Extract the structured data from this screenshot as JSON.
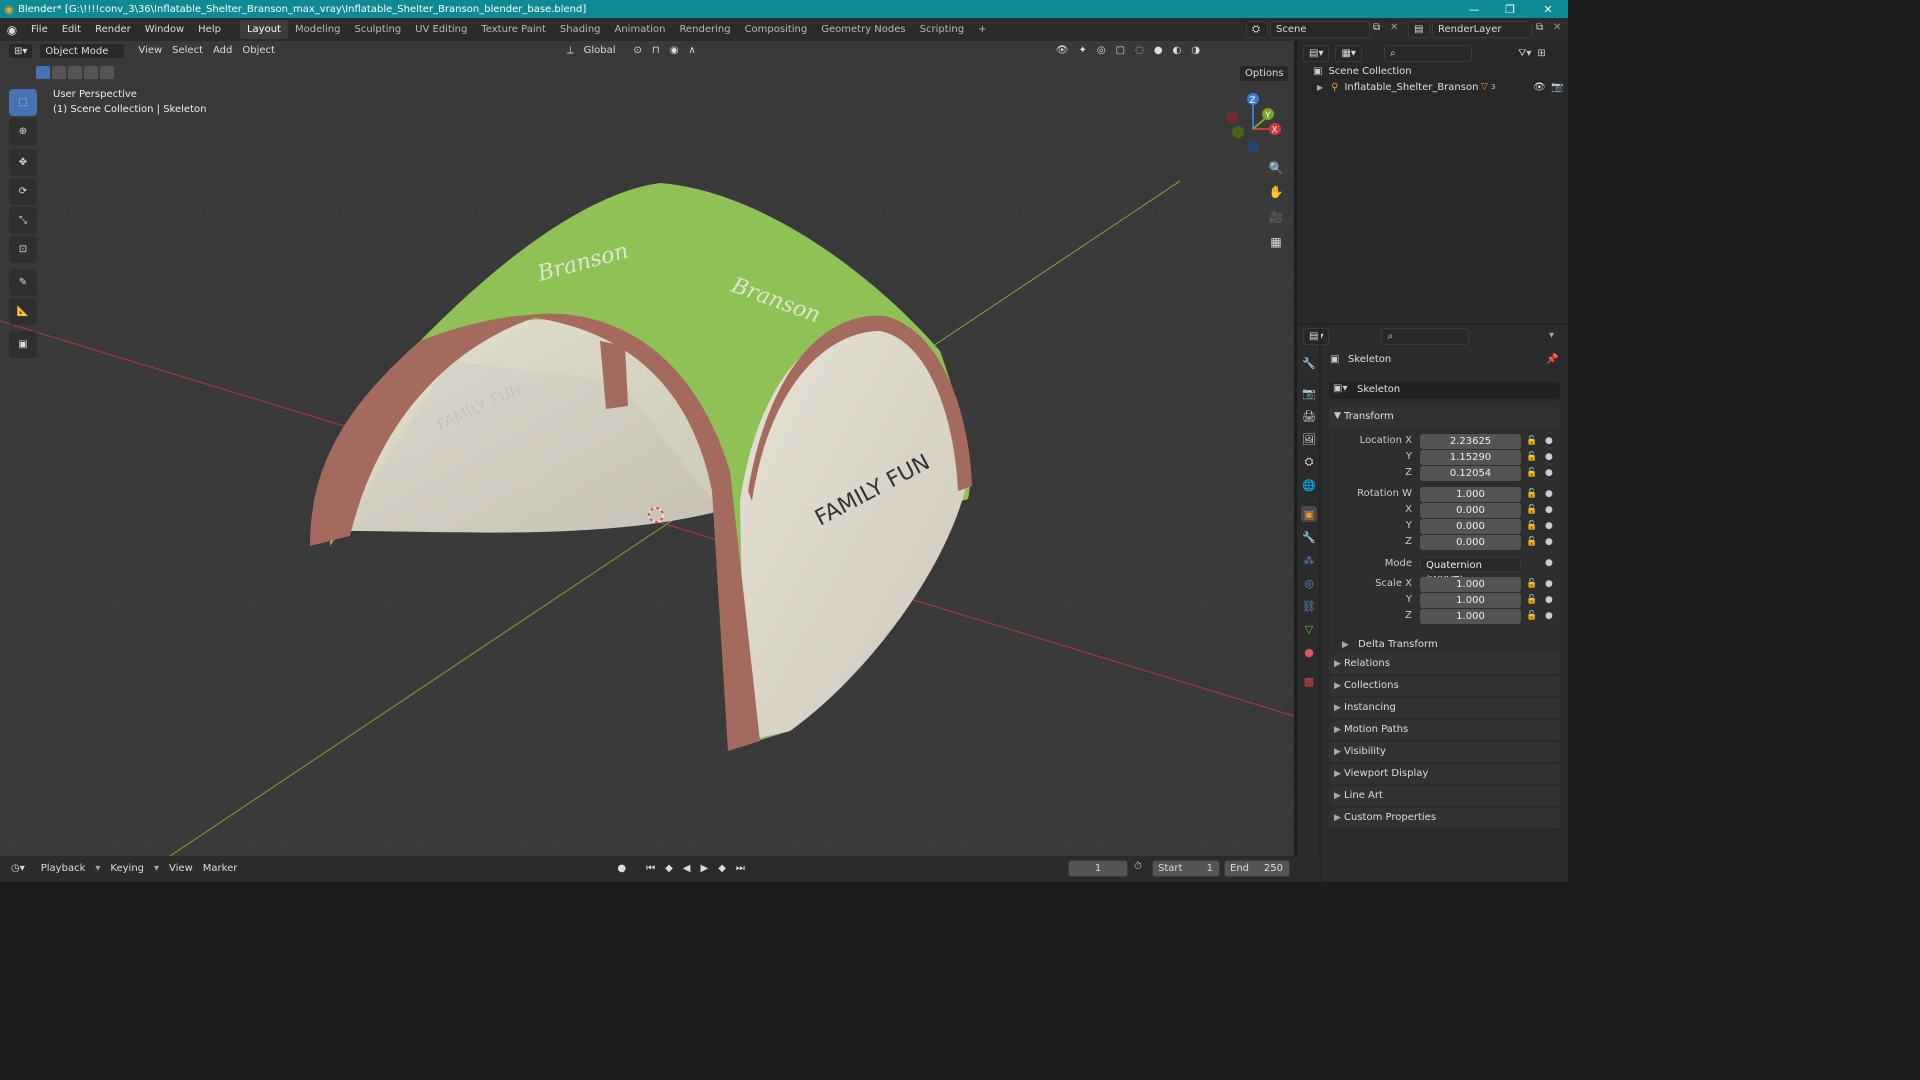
{
  "title": "Blender* [G:\\!!!!conv_3\\36\\Inflatable_Shelter_Branson_max_vray\\Inflatable_Shelter_Branson_blender_base.blend]",
  "menu": [
    "File",
    "Edit",
    "Render",
    "Window",
    "Help"
  ],
  "workspaces": [
    "Layout",
    "Modeling",
    "Sculpting",
    "UV Editing",
    "Texture Paint",
    "Shading",
    "Animation",
    "Rendering",
    "Compositing",
    "Geometry Nodes",
    "Scripting"
  ],
  "scene_name": "Scene",
  "view_layer": "RenderLayer",
  "viewport": {
    "mode": "Object Mode",
    "menus": [
      "View",
      "Select",
      "Add",
      "Object"
    ],
    "transform_orientation": "Global",
    "options": "Options",
    "perspective": "User Perspective",
    "collection_info": "(1) Scene Collection | Skeleton",
    "tent_text_front": "FAMILY FUN",
    "tent_text_back": "FAMILY FUN",
    "brand": "Branson",
    "gizmo": {
      "x": "X",
      "y": "Y",
      "z": "Z"
    }
  },
  "outliner": {
    "root": "Scene Collection",
    "items": [
      {
        "name": "Inflatable_Shelter_Branson",
        "badge": "3"
      }
    ]
  },
  "properties": {
    "object_name": "Skeleton",
    "datablock_name": "Skeleton",
    "transform_title": "Transform",
    "location": {
      "label": "Location X",
      "x": "2.23625",
      "y": "1.15290",
      "z": "0.12054"
    },
    "rotation": {
      "label": "Rotation W",
      "w": "1.000",
      "x": "0.000",
      "y": "0.000",
      "z": "0.000"
    },
    "mode_label": "Mode",
    "mode_value": "Quaternion (WXYZ)",
    "scale": {
      "label": "Scale X",
      "x": "1.000",
      "y": "1.000",
      "z": "1.000"
    },
    "axis_labels": {
      "x": "X",
      "y": "Y",
      "z": "Z"
    },
    "delta_transform": "Delta Transform",
    "panels": [
      "Relations",
      "Collections",
      "Instancing",
      "Motion Paths",
      "Visibility",
      "Viewport Display",
      "Line Art",
      "Custom Properties"
    ]
  },
  "timeline": {
    "menus": [
      "Playback",
      "Keying",
      "View",
      "Marker"
    ],
    "current_frame": "1",
    "start_label": "Start",
    "start": "1",
    "end_label": "End",
    "end": "250"
  },
  "colors": {
    "accent": "#4772b3",
    "titlebar": "#0e8a94",
    "tent_green": "#8fc157",
    "tent_frame": "#a56a5e"
  }
}
